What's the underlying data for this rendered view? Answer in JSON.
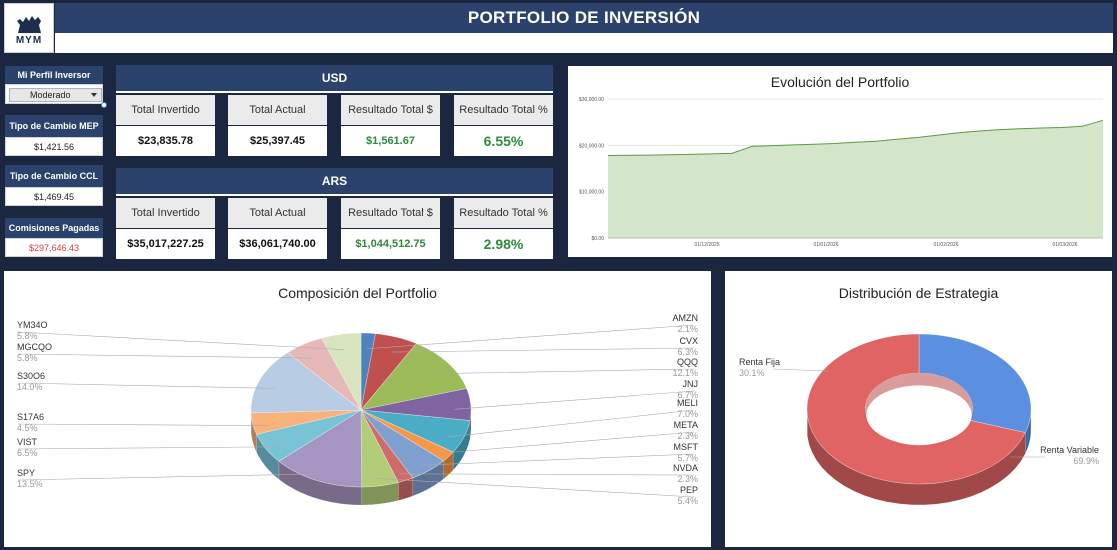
{
  "logo": {
    "text": "MYM"
  },
  "header": {
    "title": "PORTFOLIO DE INVERSIÓN"
  },
  "sidebar": {
    "profile_label": "Mi Perfil Inversor",
    "profile_value": "Moderado",
    "mep_label": "Tipo de Cambio MEP",
    "mep_value": "$1,421.56",
    "ccl_label": "Tipo de Cambio CCL",
    "ccl_value": "$1,469.45",
    "fees_label": "Comisiones Pagadas",
    "fees_value": "$297,646.43",
    "fees_color": "#e03a3a"
  },
  "usd": {
    "title": "USD",
    "labels": [
      "Total Invertido",
      "Total Actual",
      "Resultado Total $",
      "Resultado Total %"
    ],
    "values": [
      "$23,835.78",
      "$25,397.45",
      "$1,561.67",
      "6.55%"
    ]
  },
  "ars": {
    "title": "ARS",
    "labels": [
      "Total Invertido",
      "Total Actual",
      "Resultado Total $",
      "Resultado Total %"
    ],
    "values": [
      "$35,017,227.25",
      "$36,061,740.00",
      "$1,044,512.75",
      "2.98%"
    ]
  },
  "colors": {
    "header": "#2b436c",
    "background": "#1b2640",
    "positive": "#2e8b3c"
  },
  "evolution": {
    "title": "Evolución del Portfolio",
    "chart_data": {
      "type": "area",
      "title": "Evolución del Portfolio",
      "y_ticks": [
        "$30,000.00",
        "$20,000.00",
        "$10,000.00",
        "$0.00"
      ],
      "x_ticks": [
        "01/12/2025",
        "01/01/2026",
        "01/02/2026",
        "01/03/2026"
      ],
      "ylim": [
        0,
        30000
      ],
      "grid": true,
      "series": [
        {
          "values": [
            17800,
            17850,
            17900,
            17950,
            18050,
            18150,
            18250,
            19800,
            19950,
            20100,
            20250,
            20400,
            20650,
            20900,
            21300,
            21700,
            22200,
            22700,
            23100,
            23400,
            23600,
            23750,
            23850,
            24100,
            25400
          ]
        }
      ]
    }
  },
  "composition": {
    "title": "Composición del Portfolio",
    "chart_data": {
      "type": "pie",
      "title": "Composición del Portfolio",
      "slices": [
        {
          "label": "AMZN",
          "value": 2.1,
          "pct": "2.1%",
          "color": "#4f81bd"
        },
        {
          "label": "CVX",
          "value": 6.3,
          "pct": "6.3%",
          "color": "#c0504d"
        },
        {
          "label": "QQQ",
          "value": 12.1,
          "pct": "12.1%",
          "color": "#9bbb59"
        },
        {
          "label": "JNJ",
          "value": 6.7,
          "pct": "6.7%",
          "color": "#8064a2"
        },
        {
          "label": "MELI",
          "value": 7.0,
          "pct": "7.0%",
          "color": "#4bacc6"
        },
        {
          "label": "META",
          "value": 2.3,
          "pct": "2.3%",
          "color": "#f79646"
        },
        {
          "label": "MSFT",
          "value": 5.7,
          "pct": "5.7%",
          "color": "#7f9fcf"
        },
        {
          "label": "NVDA",
          "value": 2.3,
          "pct": "2.3%",
          "color": "#d06b6b"
        },
        {
          "label": "PEP",
          "value": 5.4,
          "pct": "5.4%",
          "color": "#b2cc7a"
        },
        {
          "label": "SPY",
          "value": 13.5,
          "pct": "13.5%",
          "color": "#a695c0"
        },
        {
          "label": "VIST",
          "value": 6.5,
          "pct": "6.5%",
          "color": "#78c3d6"
        },
        {
          "label": "S17A6",
          "value": 4.5,
          "pct": "4.5%",
          "color": "#fab27c"
        },
        {
          "label": "S30O6",
          "value": 14.0,
          "pct": "14.0%",
          "color": "#b8cce4"
        },
        {
          "label": "MGCQO",
          "value": 5.8,
          "pct": "5.8%",
          "color": "#e6b9b8"
        },
        {
          "label": "YM34O",
          "value": 5.8,
          "pct": "5.8%",
          "color": "#d7e4bd"
        }
      ]
    }
  },
  "strategy": {
    "title": "Distribución de Estrategia",
    "chart_data": {
      "type": "pie",
      "title": "Distribución de Estrategia",
      "slices": [
        {
          "label": "Renta Fija",
          "value": 30.1,
          "pct": "30.1%",
          "color": "#5b8fe0"
        },
        {
          "label": "Renta Variable",
          "value": 69.9,
          "pct": "69.9%",
          "color": "#e06464"
        }
      ]
    }
  }
}
